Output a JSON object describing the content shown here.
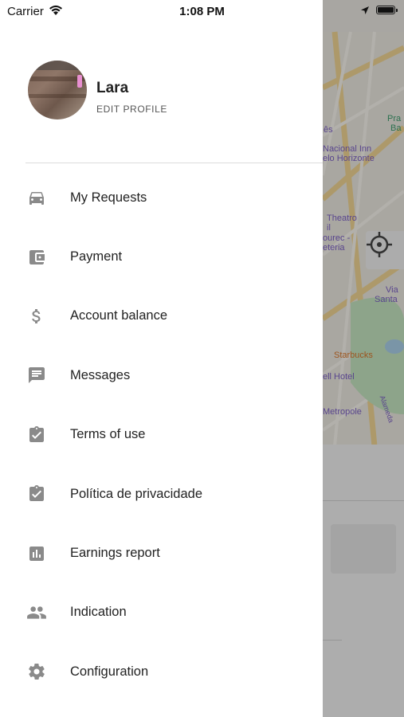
{
  "status_bar": {
    "carrier": "Carrier",
    "time": "1:08 PM"
  },
  "profile": {
    "name": "Lara",
    "edit_label": "EDIT PROFILE"
  },
  "menu": [
    {
      "label": "My Requests",
      "icon": "car-icon"
    },
    {
      "label": "Payment",
      "icon": "wallet-icon"
    },
    {
      "label": "Account balance",
      "icon": "dollar-icon"
    },
    {
      "label": "Messages",
      "icon": "message-icon"
    },
    {
      "label": "Terms of use",
      "icon": "clipboard-check-icon"
    },
    {
      "label": "Política de privacidade",
      "icon": "clipboard-check-icon"
    },
    {
      "label": "Earnings report",
      "icon": "bar-chart-icon"
    },
    {
      "label": "Indication",
      "icon": "people-icon"
    },
    {
      "label": "Configuration",
      "icon": "gear-icon"
    }
  ],
  "map": {
    "labels": [
      "Pra",
      "Ba",
      "ês",
      "Nacional Inn",
      "elo Horizonte",
      "Theatro",
      "il",
      "ourec -",
      "eteria",
      "Via",
      "Santa",
      "Starbucks",
      "ell Hotel",
      "Alameda",
      "Metropole"
    ]
  },
  "colors": {
    "icon": "#8a8a8a",
    "map_poi": "#7b5fc4",
    "map_orange": "#d9762b",
    "map_road": "#f4d68b"
  }
}
